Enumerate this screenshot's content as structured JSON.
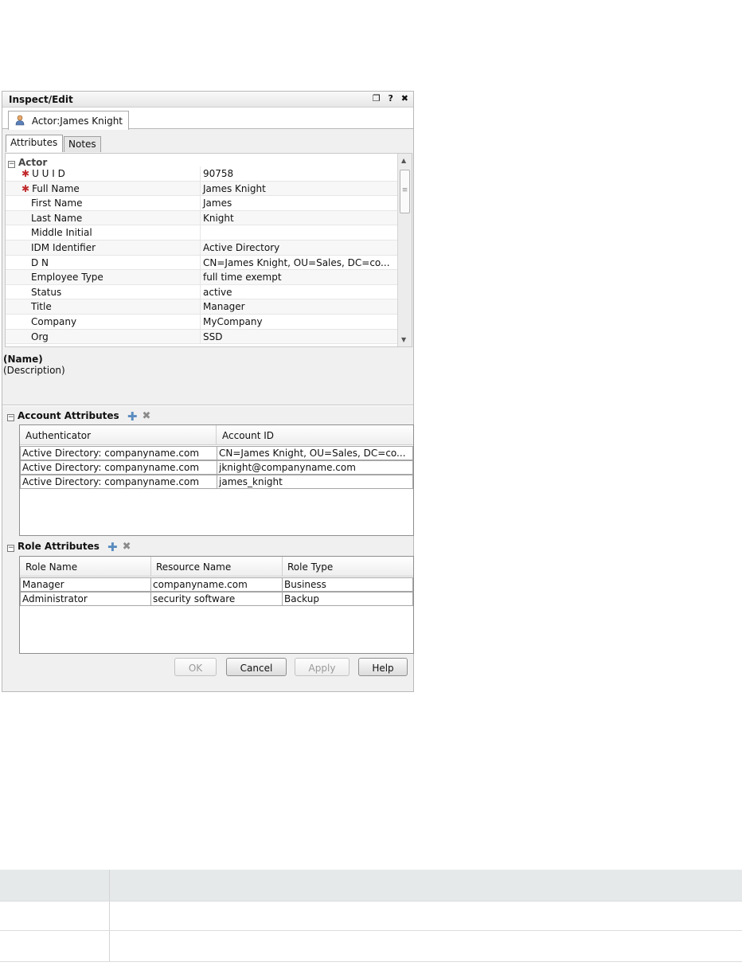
{
  "window": {
    "title": "Inspect/Edit",
    "controls": [
      "restore-icon",
      "help-icon",
      "close-icon"
    ],
    "control_glyphs": [
      "❐",
      "?",
      "✖"
    ]
  },
  "doc_tab": {
    "label": "Actor:James Knight",
    "icon": "person-icon"
  },
  "sub_tabs": [
    {
      "label": "Attributes",
      "active": true
    },
    {
      "label": "Notes",
      "active": false
    }
  ],
  "actor": {
    "section_label": "Actor",
    "properties": [
      {
        "key": "U U I D",
        "value": "90758",
        "required": true
      },
      {
        "key": "Full Name",
        "value": "James Knight",
        "required": true
      },
      {
        "key": "First Name",
        "value": "James",
        "required": false
      },
      {
        "key": "Last Name",
        "value": "Knight",
        "required": false
      },
      {
        "key": "Middle Initial",
        "value": "",
        "required": false
      },
      {
        "key": "IDM Identifier",
        "value": "Active Directory",
        "required": false
      },
      {
        "key": "D N",
        "value": "CN=James Knight, OU=Sales, DC=co...",
        "required": false
      },
      {
        "key": "Employee Type",
        "value": "full time exempt",
        "required": false
      },
      {
        "key": "Status",
        "value": "active",
        "required": false
      },
      {
        "key": "Title",
        "value": "Manager",
        "required": false
      },
      {
        "key": "Company",
        "value": "MyCompany",
        "required": false
      },
      {
        "key": "Org",
        "value": "SSD",
        "required": false
      }
    ]
  },
  "description": {
    "name": "(Name)",
    "text": "(Description)"
  },
  "account_attributes": {
    "title": "Account Attributes",
    "columns": [
      "Authenticator",
      "Account ID"
    ],
    "rows": [
      [
        "Active Directory: companyname.com",
        "CN=James Knight, OU=Sales, DC=co..."
      ],
      [
        "Active Directory: companyname.com",
        "jknight@companyname.com"
      ],
      [
        "Active Directory: companyname.com",
        "james_knight"
      ]
    ]
  },
  "role_attributes": {
    "title": "Role Attributes",
    "columns": [
      "Role Name",
      "Resource Name",
      "Role Type"
    ],
    "rows": [
      [
        "Manager",
        "companyname.com",
        "Business"
      ],
      [
        "Administrator",
        "security software",
        "Backup"
      ]
    ]
  },
  "buttons": {
    "ok": {
      "label": "OK",
      "enabled": false
    },
    "cancel": {
      "label": "Cancel",
      "enabled": true
    },
    "apply": {
      "label": "Apply",
      "enabled": false
    },
    "help": {
      "label": "Help",
      "enabled": true
    }
  },
  "colors": {
    "required_marker": "#c0282b",
    "add_icon": "#5a8cbf",
    "bottom_table_header": "#e6e9ea"
  }
}
